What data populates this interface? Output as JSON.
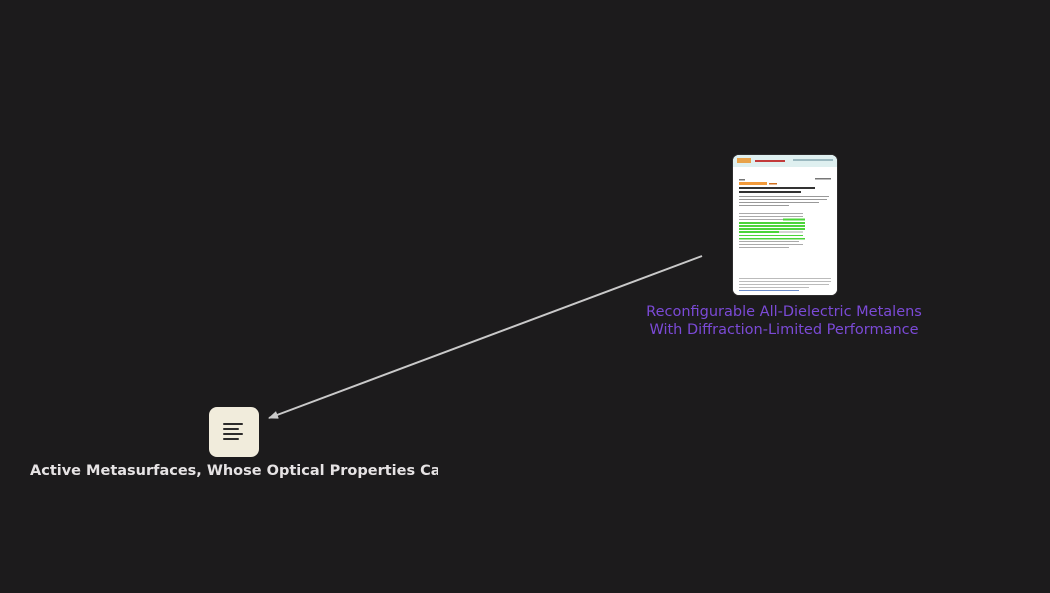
{
  "graph": {
    "nodes": [
      {
        "kind": "document",
        "icon": "document-thumbnail-icon",
        "label": "Reconfigurable All-Dielectric Metalens With Diffraction-Limited Performance",
        "label_color": "#7b4ad6"
      },
      {
        "kind": "note",
        "icon": "text-lines-icon",
        "label": "Active Metasurfaces, Whose Optical Properties Can ...",
        "label_color": "#e6e3e4"
      }
    ],
    "edges": [
      {
        "from": "Reconfigurable All-Dielectric Metalens With Diffraction-Limited Performance",
        "to": "Active Metasurfaces, Whose Optical Properties Can ...",
        "directed": true
      }
    ]
  },
  "colors": {
    "background": "#1c1b1c",
    "edge": "#c9c9c9",
    "note_fill": "#f1ecdc",
    "highlight": "#4cd43a"
  }
}
